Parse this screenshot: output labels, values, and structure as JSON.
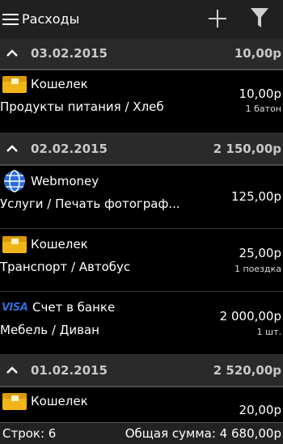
{
  "appbar": {
    "title": "Расходы"
  },
  "groups": [
    {
      "date": "03.02.2015",
      "total": "10,00р",
      "items": [
        {
          "account": "Кошелек",
          "category": "Продукты питания / Хлеб",
          "amount": "10,00р",
          "qty": "1 батон"
        }
      ]
    },
    {
      "date": "02.02.2015",
      "total": "2 150,00р",
      "items": [
        {
          "account": "Webmoney",
          "category": "Услуги / Печать фотограф...",
          "amount": "125,00р",
          "qty": ""
        },
        {
          "account": "Кошелек",
          "category": "Транспорт / Автобус",
          "amount": "25,00р",
          "qty": "1 поездка"
        },
        {
          "account": "Счет в банке",
          "category": "Мебель / Диван",
          "amount": "2 000,00р",
          "qty": "1 шт."
        }
      ]
    },
    {
      "date": "01.02.2015",
      "total": "2 520,00р",
      "items": [
        {
          "account": "Кошелек",
          "category": "",
          "amount": "20,00р",
          "qty": ""
        }
      ]
    }
  ],
  "icons": {
    "visa_text": "VISA"
  },
  "footer": {
    "rows": "Строк: 6",
    "total": "Общая сумма: 4 680,00р"
  },
  "colors": {
    "wallet": "#f2b416",
    "webmoney": "#2b6bd6",
    "visa": "#2c6fd9",
    "header_bg": "#2a2a2a"
  }
}
